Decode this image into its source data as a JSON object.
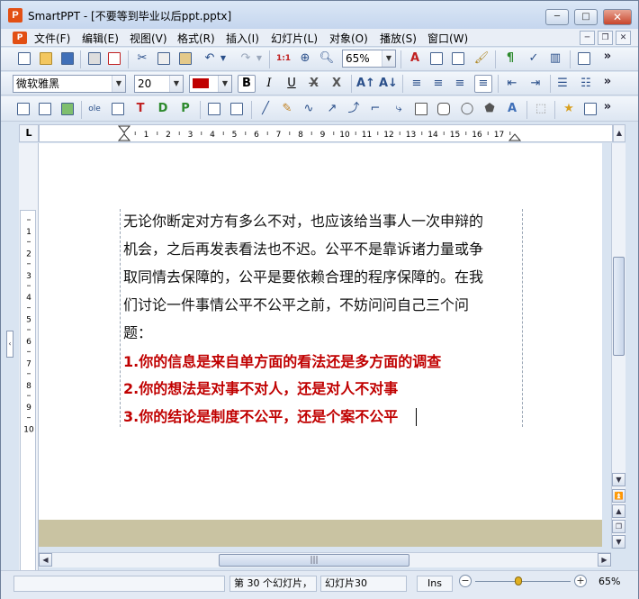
{
  "window": {
    "app_icon": "P",
    "title": "SmartPPT - [不要等到毕业以后ppt.pptx]",
    "controls": [
      "─",
      "□",
      "✕"
    ]
  },
  "menubar": {
    "doc_icon": "P",
    "items": [
      {
        "label": "文件(F)"
      },
      {
        "label": "编辑(E)"
      },
      {
        "label": "视图(V)"
      },
      {
        "label": "格式(R)"
      },
      {
        "label": "插入(I)"
      },
      {
        "label": "幻灯片(L)"
      },
      {
        "label": "对象(O)"
      },
      {
        "label": "播放(S)"
      },
      {
        "label": "窗口(W)"
      }
    ],
    "mdi_controls": [
      "─",
      "❐",
      "✕"
    ]
  },
  "toolbar1": {
    "zoom": "65%",
    "overflow": "»"
  },
  "toolbar2": {
    "font_name": "微软雅黑",
    "font_size": "20",
    "font_color": "#c00000",
    "bold": "B",
    "italic": "I",
    "underline": "U",
    "overflow": "»"
  },
  "toolbar3": {
    "overflow": "»"
  },
  "ruler": {
    "corner": "L",
    "h_ticks": [
      "1",
      "1",
      "2",
      "3",
      "4",
      "5",
      "6",
      "7",
      "8",
      "9",
      "10",
      "11",
      "12",
      "13",
      "14",
      "15",
      "16",
      "17"
    ],
    "v_ticks": [
      "1",
      "2",
      "3",
      "4",
      "5",
      "6",
      "7",
      "8",
      "9",
      "10"
    ]
  },
  "slide": {
    "paragraph_lines": [
      "无论你断定对方有多么不对，也应该给当事人一次申辩的",
      "机会，之后再发表看法也不迟。公平不是靠诉诸力量或争",
      "取同情去保障的，公平是要依赖合理的程序保障的。在我",
      "们讨论一件事情公平不公平之前，不妨问问自己三个问",
      "题："
    ],
    "questions": [
      "1.你的信息是来自单方面的看法还是多方面的调查",
      "2.你的想法是对事不对人，还是对人不对事",
      "3.你的结论是制度不公平，还是个案不公平"
    ]
  },
  "statusbar": {
    "slide_count": "第 30 个幻灯片，",
    "current_slide": "幻灯片30",
    "mode": "Ins",
    "zoom": "65%",
    "zoom_level_fraction": 0.45
  }
}
